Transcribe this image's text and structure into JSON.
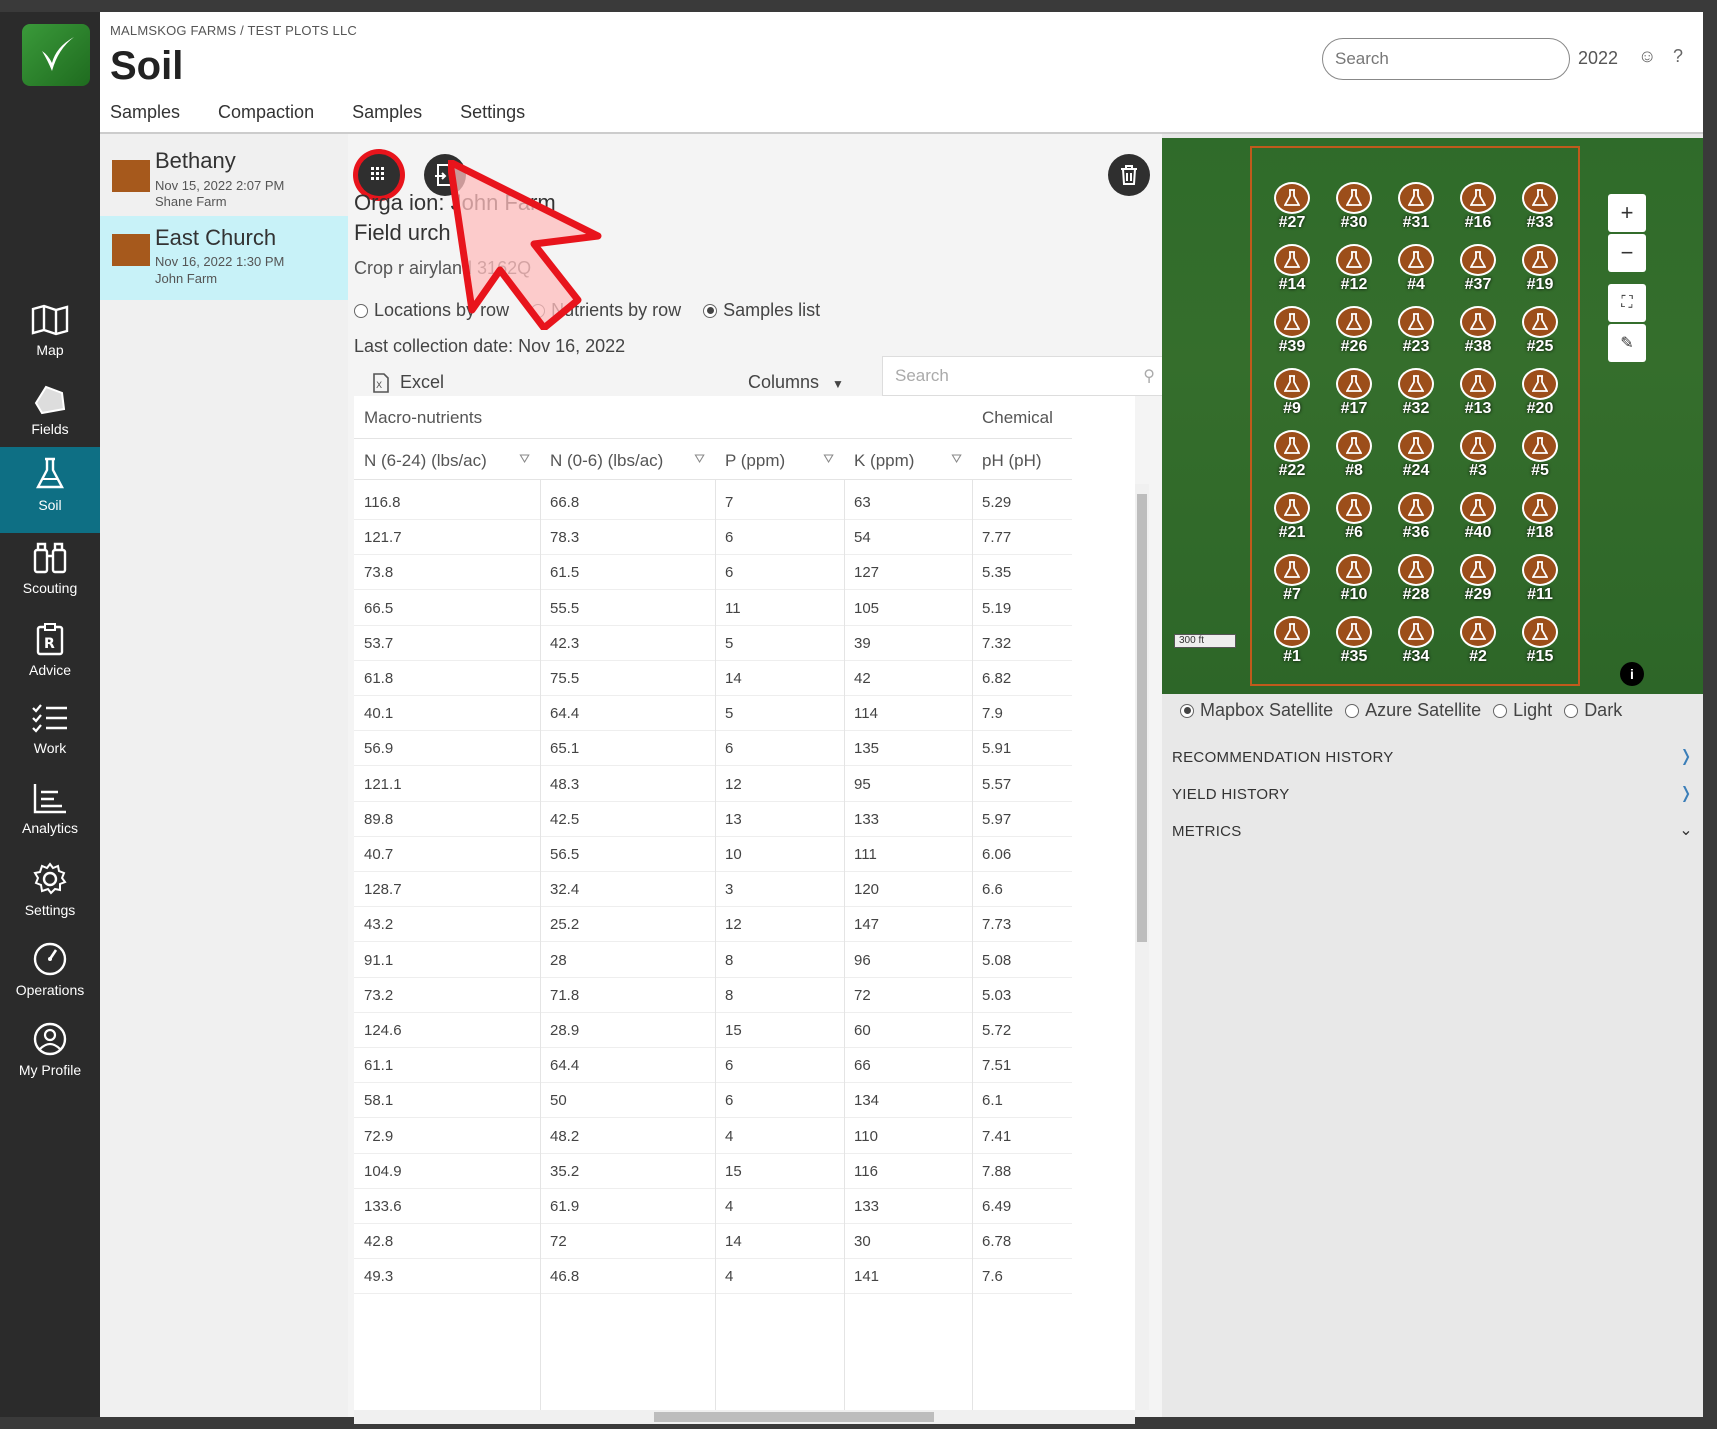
{
  "nav": {
    "items": [
      {
        "label": "Map",
        "icon": "map-icon"
      },
      {
        "label": "Fields",
        "icon": "fields-icon"
      },
      {
        "label": "Soil",
        "icon": "flask-icon"
      },
      {
        "label": "Scouting",
        "icon": "binoculars-icon"
      },
      {
        "label": "Advice",
        "icon": "prescription-icon"
      },
      {
        "label": "Work",
        "icon": "checklist-icon"
      },
      {
        "label": "Analytics",
        "icon": "chart-icon"
      },
      {
        "label": "Settings",
        "icon": "gear-icon"
      },
      {
        "label": "Operations",
        "icon": "gauge-icon"
      },
      {
        "label": "My Profile",
        "icon": "user-icon"
      }
    ],
    "active": "Soil"
  },
  "header": {
    "breadcrumb": "MALMSKOG FARMS / TEST PLOTS LLC",
    "title": "Soil",
    "search_placeholder": "Search",
    "year": "2022",
    "smile": "☺",
    "help": "?"
  },
  "tabs": [
    {
      "label": "Samples"
    },
    {
      "label": "Compaction"
    },
    {
      "label": "Samples"
    },
    {
      "label": "Settings"
    }
  ],
  "fields": [
    {
      "name": "Bethany",
      "date": "Nov 15, 2022 2:07 PM",
      "farm": "Shane Farm",
      "color": "#a6591c"
    },
    {
      "name": "East Church",
      "date": "Nov 16, 2022 1:30 PM",
      "farm": "John Farm",
      "color": "#a6591c"
    }
  ],
  "detail": {
    "org_line": "Orga      ion:  John Farm",
    "field_line": "Field             urch",
    "crop_line": "Crop r          airyland 3162Q",
    "view_options": [
      "Locations by row",
      "Nutrients by row",
      "Samples list"
    ],
    "view_selected": "Samples list",
    "last_collection": "Last collection date:  Nov 16, 2022",
    "excel_label": "Excel",
    "columns_label": "Columns",
    "search_placeholder": "Search"
  },
  "table": {
    "groups": [
      "Macro-nutrients",
      "Chemical"
    ],
    "headers": [
      "N (6-24) (lbs/ac)",
      "N (0-6) (lbs/ac)",
      "P (ppm)",
      "K (ppm)",
      "pH (pH)"
    ],
    "rows": [
      [
        "116.8",
        "66.8",
        "7",
        "63",
        "5.29"
      ],
      [
        "121.7",
        "78.3",
        "6",
        "54",
        "7.77"
      ],
      [
        "73.8",
        "61.5",
        "6",
        "127",
        "5.35"
      ],
      [
        "66.5",
        "55.5",
        "11",
        "105",
        "5.19"
      ],
      [
        "53.7",
        "42.3",
        "5",
        "39",
        "7.32"
      ],
      [
        "61.8",
        "75.5",
        "14",
        "42",
        "6.82"
      ],
      [
        "40.1",
        "64.4",
        "5",
        "114",
        "7.9"
      ],
      [
        "56.9",
        "65.1",
        "6",
        "135",
        "5.91"
      ],
      [
        "121.1",
        "48.3",
        "12",
        "95",
        "5.57"
      ],
      [
        "89.8",
        "42.5",
        "13",
        "133",
        "5.97"
      ],
      [
        "40.7",
        "56.5",
        "10",
        "111",
        "6.06"
      ],
      [
        "128.7",
        "32.4",
        "3",
        "120",
        "6.6"
      ],
      [
        "43.2",
        "25.2",
        "12",
        "147",
        "7.73"
      ],
      [
        "91.1",
        "28",
        "8",
        "96",
        "5.08"
      ],
      [
        "73.2",
        "71.8",
        "8",
        "72",
        "5.03"
      ],
      [
        "124.6",
        "28.9",
        "15",
        "60",
        "5.72"
      ],
      [
        "61.1",
        "64.4",
        "6",
        "66",
        "7.51"
      ],
      [
        "58.1",
        "50",
        "6",
        "134",
        "6.1"
      ],
      [
        "72.9",
        "48.2",
        "4",
        "110",
        "7.41"
      ],
      [
        "104.9",
        "35.2",
        "15",
        "116",
        "7.88"
      ],
      [
        "133.6",
        "61.9",
        "4",
        "133",
        "6.49"
      ],
      [
        "42.8",
        "72",
        "14",
        "30",
        "6.78"
      ],
      [
        "49.3",
        "46.8",
        "4",
        "141",
        "7.6"
      ]
    ]
  },
  "map": {
    "markers": [
      [
        "#27",
        "#30",
        "#31",
        "#16",
        "#33"
      ],
      [
        "#14",
        "#12",
        "#4",
        "#37",
        "#19"
      ],
      [
        "#39",
        "#26",
        "#23",
        "#38",
        "#25"
      ],
      [
        "#9",
        "#17",
        "#32",
        "#13",
        "#20"
      ],
      [
        "#22",
        "#8",
        "#24",
        "#3",
        "#5"
      ],
      [
        "#21",
        "#6",
        "#36",
        "#40",
        "#18"
      ],
      [
        "#7",
        "#10",
        "#28",
        "#29",
        "#11"
      ],
      [
        "#1",
        "#35",
        "#34",
        "#2",
        "#15"
      ]
    ],
    "scale": "300 ft",
    "zoom_in": "+",
    "zoom_out": "−",
    "layers": [
      "Mapbox Satellite",
      "Azure Satellite",
      "Light",
      "Dark"
    ],
    "layer_selected": "Mapbox Satellite",
    "field_boundary_color": "#c05a1c",
    "marker_color": "#9c4e1a"
  },
  "sections": [
    {
      "label": "RECOMMENDATION HISTORY",
      "state": "collapsed"
    },
    {
      "label": "YIELD HISTORY",
      "state": "collapsed"
    },
    {
      "label": "METRICS",
      "state": "expanded"
    }
  ],
  "colors": {
    "accent": "#0e6f84",
    "highlight_ring": "#e8141c",
    "selected_field": "#c8f2f8"
  }
}
